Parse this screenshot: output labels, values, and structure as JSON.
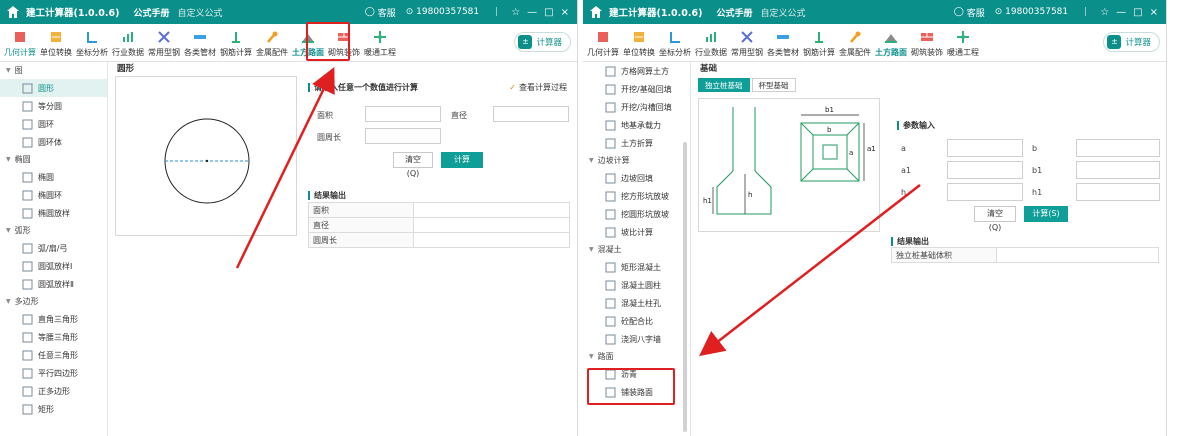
{
  "app": {
    "title": "建工计算器(1.0.0.6)",
    "tabs": [
      "公式手册",
      "自定义公式"
    ],
    "service": "客服",
    "account": "19800357581",
    "window_controls": [
      "☆",
      "—",
      "□",
      "×"
    ]
  },
  "toolbar": {
    "items": [
      "几何计算",
      "单位转换",
      "坐标分析",
      "行业数据",
      "常用型钢",
      "各类管材",
      "钢筋计算",
      "金属配件",
      "土方路面",
      "砌筑装饰",
      "暖通工程"
    ],
    "calc_button": "计算器"
  },
  "left_window": {
    "sidebar": [
      {
        "group": "图",
        "items": [
          "圆形",
          "等分圆",
          "圆环",
          "圆环体"
        ]
      },
      {
        "group": "椭圆",
        "items": [
          "椭圆",
          "椭圆环",
          "椭圆放样"
        ]
      },
      {
        "group": "弧形",
        "items": [
          "弧/扇/弓",
          "圆弧放样Ⅰ",
          "圆弧放样Ⅱ"
        ]
      },
      {
        "group": "多边形",
        "items": [
          "直角三角形",
          "等腰三角形",
          "任意三角形",
          "平行四边形",
          "正多边形",
          "矩形"
        ]
      }
    ],
    "active_item": "圆形",
    "section_title": "圆形",
    "input_heading": "请输入任意一个数值进行计算",
    "view_process": "查看计算过程",
    "fields": [
      "面积",
      "直径",
      "圆周长"
    ],
    "clear_button": "清空(Q)",
    "calc_button": "计算(S)",
    "result_heading": "结果输出",
    "results": [
      "面积",
      "直径",
      "圆周长"
    ]
  },
  "right_window": {
    "sidebar": [
      {
        "items": [
          "方格网算土方",
          "开挖/基础回填",
          "开挖/沟槽回填",
          "地基承载力",
          "土方折算"
        ]
      },
      {
        "group": "边坡计算",
        "items": [
          "边坡回填",
          "挖方形坑放坡",
          "挖圆形坑放坡",
          "坡比计算"
        ]
      },
      {
        "group": "混凝土",
        "items": [
          "矩形混凝土",
          "混凝土圆柱",
          "混凝土柱孔",
          "砼配合比",
          "浇洞八字墙"
        ]
      },
      {
        "group": "路面",
        "items": [
          "沥青",
          "铺装路面"
        ]
      }
    ],
    "section_title": "基础",
    "subtabs": [
      "独立桩基础",
      "杯型基础"
    ],
    "diagram_labels": {
      "h1_left": "h1",
      "h_left": "h",
      "b1": "b1",
      "b": "b",
      "a": "a",
      "a1": "a1"
    },
    "input_heading": "参数输入",
    "params_left": [
      "a",
      "a1",
      "h"
    ],
    "params_right": [
      "b",
      "b1",
      "h1"
    ],
    "clear_button": "清空(Q)",
    "calc_button": "计算(S)",
    "result_heading": "结果输出",
    "results": [
      "独立桩基础体积"
    ]
  },
  "colors": {
    "accent": "#0a8f8a",
    "highlight": "#e02020",
    "arrow": "#e02020"
  }
}
